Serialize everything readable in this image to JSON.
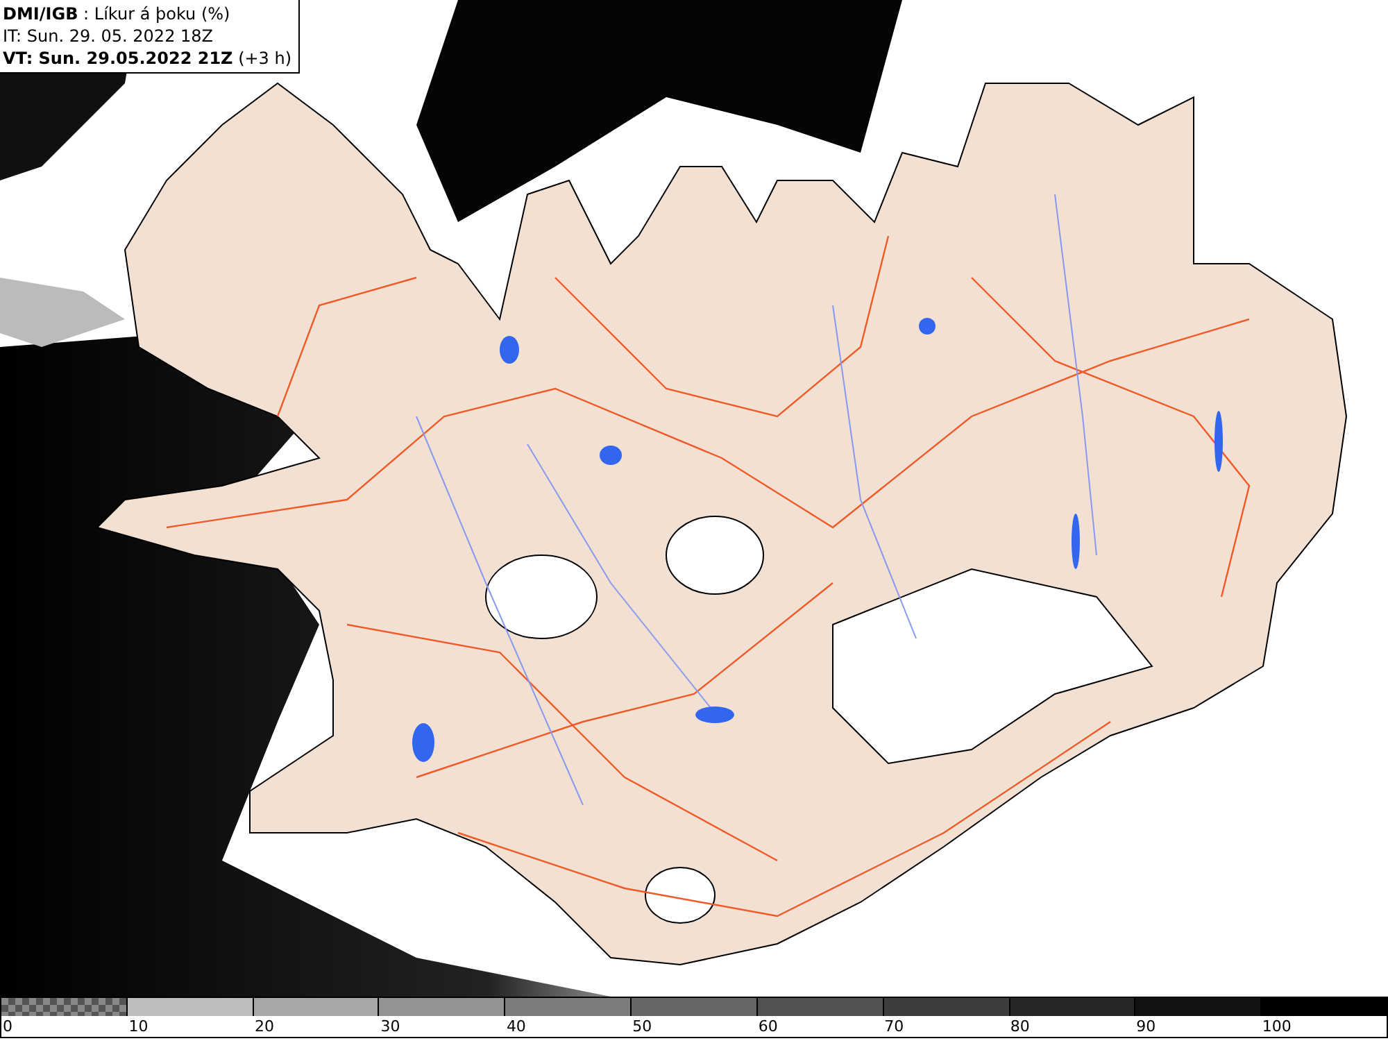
{
  "header": {
    "source": "DMI/IGB",
    "product": " : Líkur á þoku (%)",
    "issue_time": "IT: Sun. 29. 05. 2022 18Z",
    "valid_label": "VT: Sun. 29.05.2022 21Z",
    "valid_offset": "(+3 h)"
  },
  "legend": [
    {
      "label": "0",
      "kind": "checker"
    },
    {
      "label": "10",
      "kind": "solid",
      "color": "#bdbdbd"
    },
    {
      "label": "20",
      "kind": "solid",
      "color": "#a8a8a8"
    },
    {
      "label": "30",
      "kind": "solid",
      "color": "#939393"
    },
    {
      "label": "40",
      "kind": "solid",
      "color": "#7d7d7d"
    },
    {
      "label": "50",
      "kind": "solid",
      "color": "#676767"
    },
    {
      "label": "60",
      "kind": "solid",
      "color": "#525252"
    },
    {
      "label": "70",
      "kind": "solid",
      "color": "#3d3d3d"
    },
    {
      "label": "80",
      "kind": "solid",
      "color": "#262626"
    },
    {
      "label": "90",
      "kind": "solid",
      "color": "#121212"
    },
    {
      "label": "100",
      "kind": "solid",
      "color": "#000000"
    }
  ]
}
